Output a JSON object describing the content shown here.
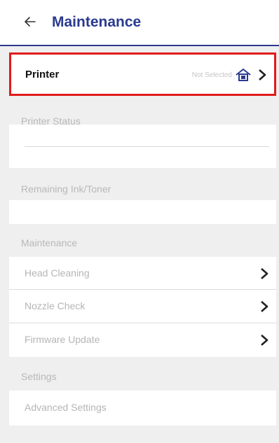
{
  "header": {
    "back_icon": "back-arrow-icon",
    "title": "Maintenance",
    "accent": "#2a3a8e"
  },
  "printer": {
    "label": "Printer",
    "value": "Not Selected",
    "icon": "home-printer-icon",
    "highlight": "#e01b1b"
  },
  "sections": {
    "printer_status": "Printer Status",
    "remaining": "Remaining Ink/Toner",
    "maintenance": "Maintenance",
    "settings": "Settings"
  },
  "maintenance_items": {
    "head_cleaning": "Head Cleaning",
    "nozzle_check": "Nozzle Check",
    "firmware_update": "Firmware Update"
  },
  "settings_items": {
    "advanced": "Advanced Settings"
  }
}
